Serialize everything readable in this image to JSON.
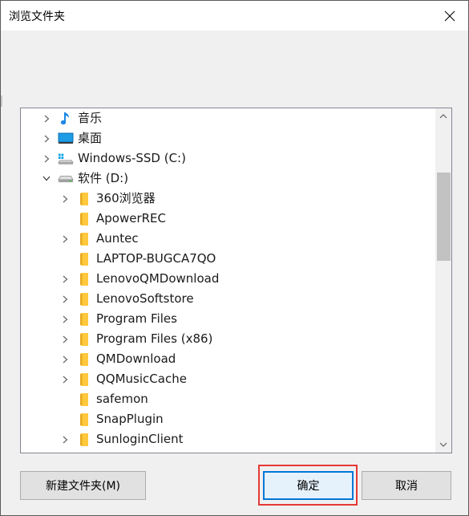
{
  "dialog": {
    "title": "浏览文件夹"
  },
  "tree": {
    "items": [
      {
        "label": "音乐",
        "icon": "music-note-icon",
        "expandable": true,
        "expanded": false,
        "level": 0
      },
      {
        "label": "桌面",
        "icon": "desktop-icon",
        "expandable": true,
        "expanded": false,
        "level": 0
      },
      {
        "label": "Windows-SSD (C:)",
        "icon": "windows-drive-icon",
        "expandable": true,
        "expanded": false,
        "level": 0
      },
      {
        "label": "软件 (D:)",
        "icon": "drive-icon",
        "expandable": true,
        "expanded": true,
        "level": 0
      },
      {
        "label": "360浏览器",
        "icon": "folder-icon",
        "expandable": true,
        "expanded": false,
        "level": 1
      },
      {
        "label": "ApowerREC",
        "icon": "folder-icon",
        "expandable": false,
        "expanded": false,
        "level": 1
      },
      {
        "label": "Auntec",
        "icon": "folder-icon",
        "expandable": true,
        "expanded": false,
        "level": 1
      },
      {
        "label": "LAPTOP-BUGCA7QO",
        "icon": "folder-icon",
        "expandable": false,
        "expanded": false,
        "level": 1
      },
      {
        "label": "LenovoQMDownload",
        "icon": "folder-icon",
        "expandable": true,
        "expanded": false,
        "level": 1
      },
      {
        "label": "LenovoSoftstore",
        "icon": "folder-icon",
        "expandable": true,
        "expanded": false,
        "level": 1
      },
      {
        "label": "Program Files",
        "icon": "folder-icon",
        "expandable": true,
        "expanded": false,
        "level": 1
      },
      {
        "label": "Program Files (x86)",
        "icon": "folder-icon",
        "expandable": true,
        "expanded": false,
        "level": 1
      },
      {
        "label": "QMDownload",
        "icon": "folder-icon",
        "expandable": true,
        "expanded": false,
        "level": 1
      },
      {
        "label": "QQMusicCache",
        "icon": "folder-icon",
        "expandable": true,
        "expanded": false,
        "level": 1
      },
      {
        "label": "safemon",
        "icon": "folder-icon",
        "expandable": false,
        "expanded": false,
        "level": 1
      },
      {
        "label": "SnapPlugin",
        "icon": "folder-icon",
        "expandable": false,
        "expanded": false,
        "level": 1
      },
      {
        "label": "SunloginClient",
        "icon": "folder-icon",
        "expandable": true,
        "expanded": false,
        "level": 1
      }
    ]
  },
  "buttons": {
    "new_folder": "新建文件夹(M)",
    "ok": "确定",
    "cancel": "取消"
  },
  "colors": {
    "folder": "#ffc83d",
    "accent": "#0078d7",
    "highlight_box": "#e53935"
  }
}
